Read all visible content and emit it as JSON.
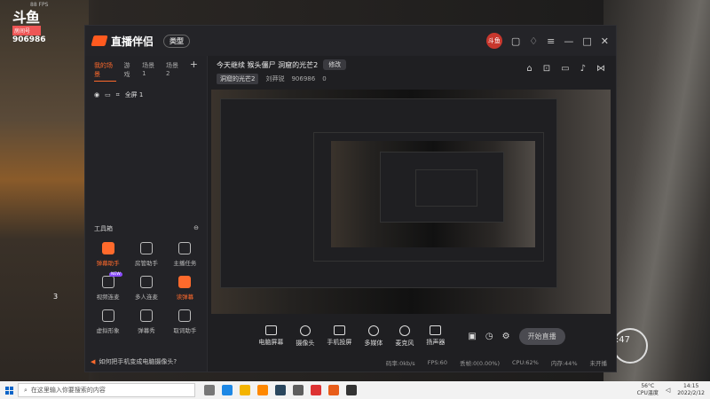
{
  "overlay": {
    "fps": "88 FPS",
    "douyu_mark": "斗鱼",
    "room_label": "房间号",
    "room_number": "906986"
  },
  "app": {
    "brand": "直播伴侣",
    "version_pill": "类型",
    "avatar_text": "斗鱼",
    "scene_tabs": [
      "我的场景",
      "游戏",
      "场景 1",
      "场景 2"
    ],
    "source_item": "全屏 1",
    "toolbox_title": "工具箱",
    "tools": [
      {
        "label": "弹幕助手",
        "hot": true,
        "badge": ""
      },
      {
        "label": "房管助手",
        "hot": false,
        "badge": ""
      },
      {
        "label": "主播任务",
        "hot": false,
        "badge": ""
      },
      {
        "label": "视频连麦",
        "hot": false,
        "badge": "NEW"
      },
      {
        "label": "多人连麦",
        "hot": false,
        "badge": ""
      },
      {
        "label": "读弹幕",
        "hot": true,
        "badge": ""
      },
      {
        "label": "虚拟形象",
        "hot": false,
        "badge": ""
      },
      {
        "label": "弹幕秀",
        "hot": false,
        "badge": ""
      },
      {
        "label": "取词助手",
        "hot": false,
        "badge": ""
      }
    ],
    "hint": "如何把手机变成电脑摄像头?",
    "stream_title": "今天继续  猴头僵尸 洞窟的光芒2",
    "edit_btn": "修改",
    "category": "洞窟的光芒2",
    "sub_user": "刘莽锐",
    "sub_room": "906986",
    "sub_count": "0",
    "bottom_items": [
      "电脑屏幕",
      "摄像头",
      "手机投屏",
      "多媒体",
      "麦克风",
      "扬声器"
    ],
    "start_btn": "开始直播",
    "status": [
      "码率:0kb/s",
      "FPS:60",
      "丢帧:0(0.00%)",
      "CPU:62%",
      "内存:44%",
      "未开播"
    ]
  },
  "hud": {
    "ammo": "3",
    "time": "0:47"
  },
  "taskbar": {
    "search_placeholder": "在这里输入你要搜索的内容",
    "temp": "56°C",
    "cpu_label": "CPU温度",
    "time": "14:15",
    "date": "2022/2/12"
  }
}
